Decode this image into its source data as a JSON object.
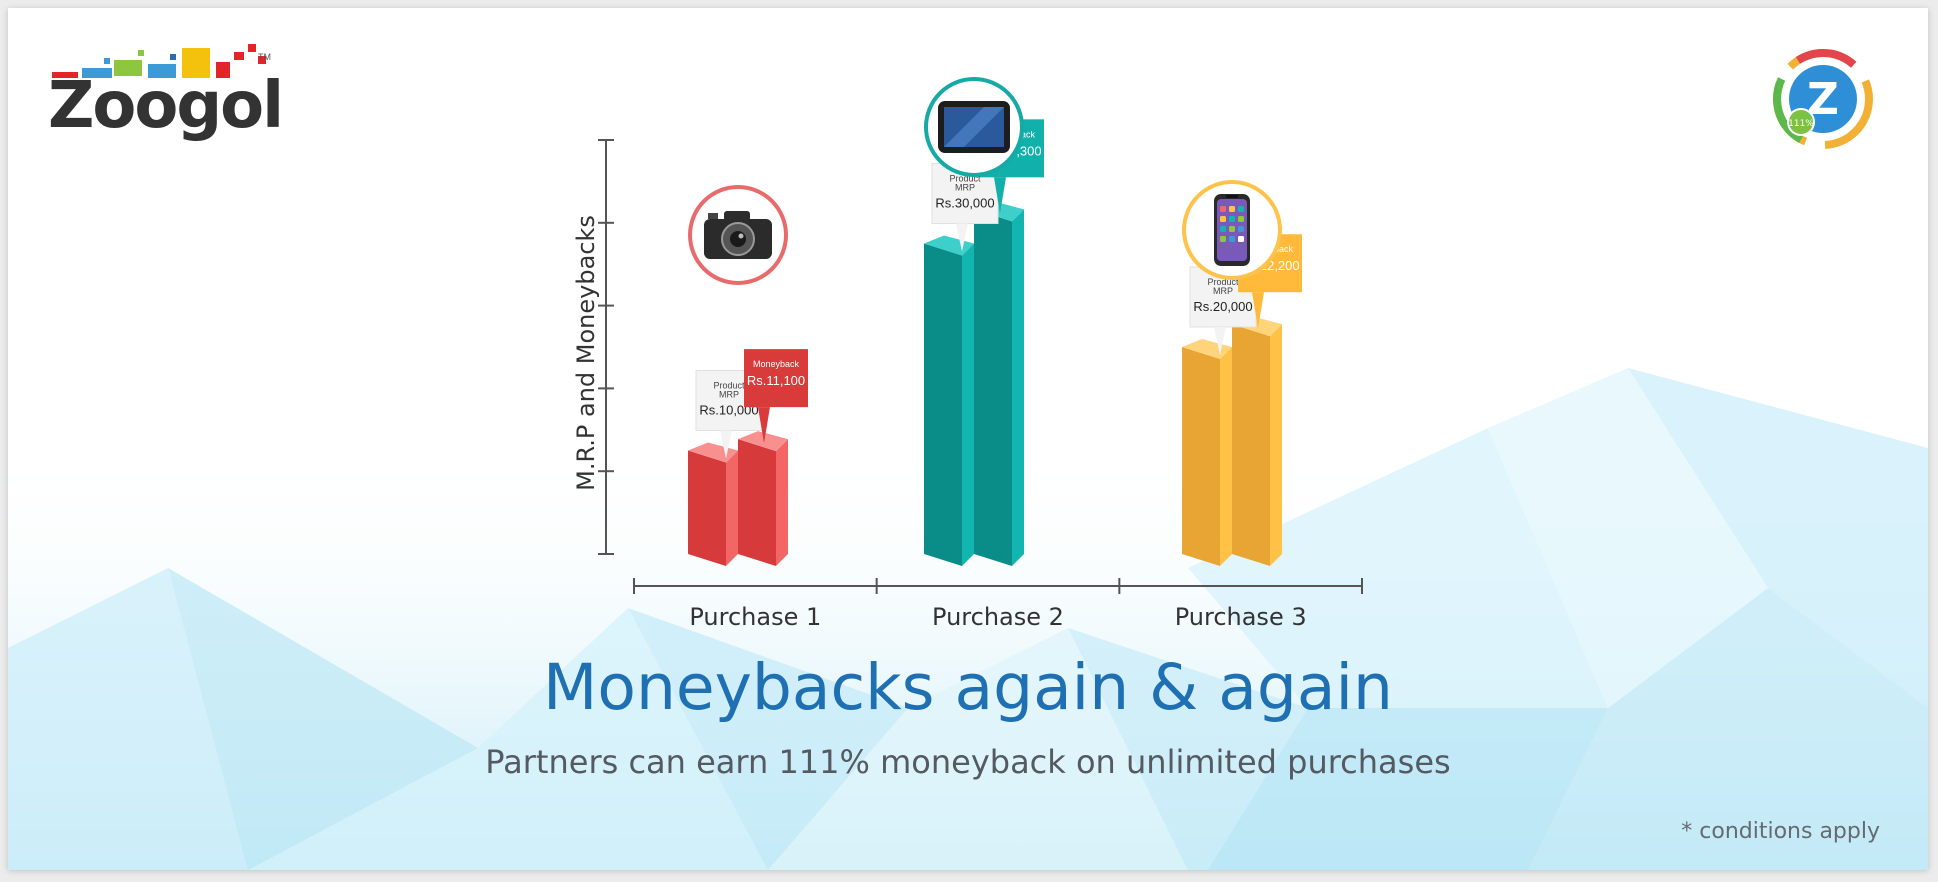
{
  "brand": {
    "name": "Zoogol",
    "trademark": "TM",
    "pixel_colors": [
      "#e2242b",
      "#3a9bd7",
      "#8dc63f",
      "#f4c20d",
      "#2b6cb0",
      "#e2242b"
    ]
  },
  "badge": {
    "icon": "zoogol-moneyback-badge-icon",
    "text": "111%"
  },
  "headline": "Moneybacks again & again",
  "subline": "Partners can earn 111% moneyback on unlimited purchases",
  "conditions": "* conditions apply",
  "chart_data": {
    "type": "bar",
    "ylabel": "M.R.P and Moneybacks",
    "xlabel": "",
    "grid": false,
    "categories": [
      "Purchase 1",
      "Purchase 2",
      "Purchase 3"
    ],
    "series": [
      {
        "values": [
          10000,
          30000,
          20000
        ]
      },
      {
        "values": [
          11100,
          33300,
          22200
        ]
      }
    ],
    "label_titles": {
      "mrp": [
        "Product",
        "MRP"
      ],
      "moneyback": "Moneyback"
    },
    "mrp_labels": [
      "Rs.10,000",
      "Rs.30,000",
      "Rs.20,000"
    ],
    "moneyback_labels": [
      "Rs.11,100",
      "Rs.33,300",
      "Rs.22,200"
    ],
    "product_icons": [
      "camera-icon",
      "tablet-icon",
      "smartphone-icon"
    ],
    "colors": [
      {
        "front": "#f26666",
        "side": "#d63a3a",
        "top": "#f89090",
        "ring": "#e96a6a",
        "moneyback_box": "#d93a3a"
      },
      {
        "front": "#12b5b0",
        "side": "#0a8c88",
        "top": "#3fcfca",
        "ring": "#15aaa6",
        "moneyback_box": "#12b0ab"
      },
      {
        "front": "#ffc247",
        "side": "#e8a533",
        "top": "#ffd47a",
        "ring": "#ffc24a",
        "moneyback_box": "#ffba3c"
      }
    ]
  }
}
